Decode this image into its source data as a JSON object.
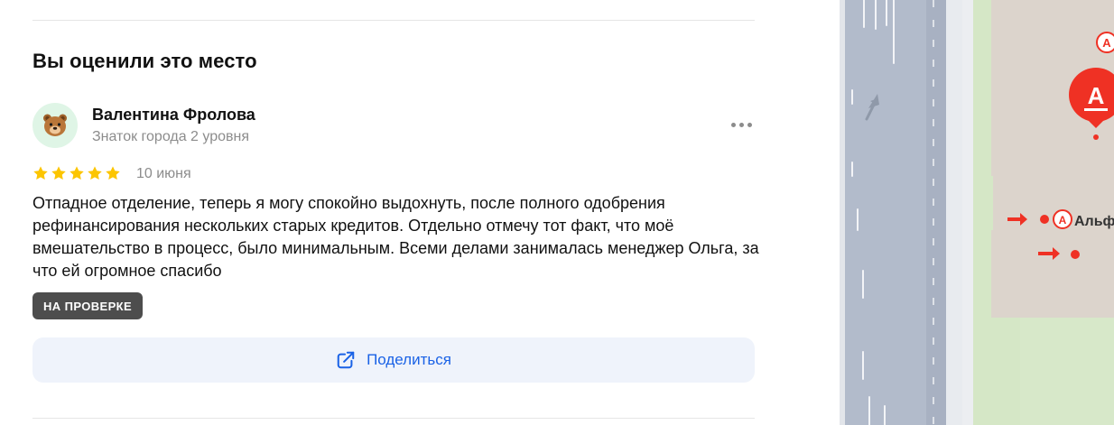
{
  "section": {
    "heading": "Вы оценили это место"
  },
  "review": {
    "author_name": "Валентина Фролова",
    "author_level": "Знаток города 2 уровня",
    "avatar_icon": "bear-face-icon",
    "rating": 5,
    "rating_max": 5,
    "date": "10 июня",
    "text": "Отпадное отделение, теперь я могу спокойно выдохнуть, после полного одобрения рефинансирования нескольких старых кредитов. Отдельно отмечу тот факт, что моё вмешательство в процесс, было минимальным. Всеми делами занималась менеджер Ольга, за что ей огромное спасибо",
    "status_badge": "НА ПРОВЕРКЕ",
    "share_label": "Поделиться",
    "share_icon": "share-external-icon",
    "more_icon": "more-dots-icon"
  },
  "map": {
    "place_label": "Альфа",
    "pin_letter": "А",
    "colors": {
      "road": "#b2bbcb",
      "green": "#d7e8c9",
      "building": "#dcd4cc",
      "brand": "#ef3124",
      "star": "#fcc500",
      "link": "#1a62e6"
    }
  }
}
